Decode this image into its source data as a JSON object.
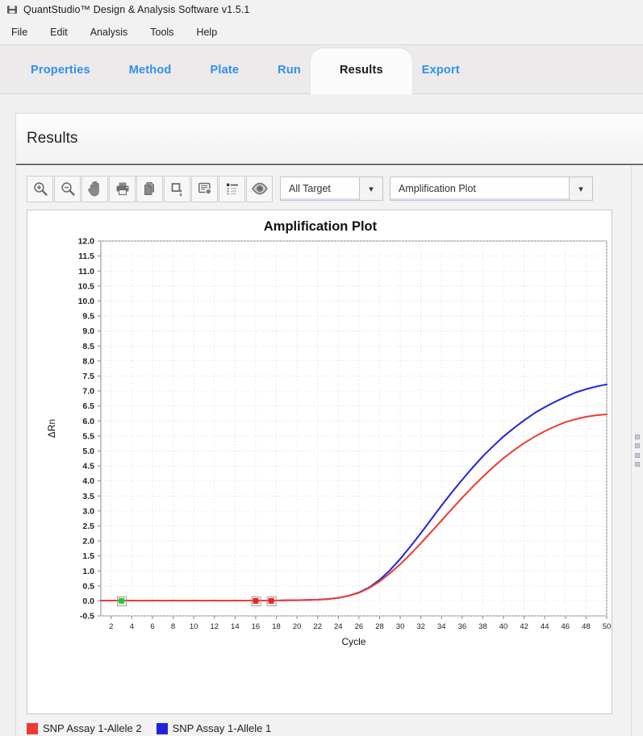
{
  "window": {
    "title": "QuantStudio™ Design & Analysis Software v1.5.1",
    "app_icon": "disk-icon"
  },
  "menubar": {
    "items": [
      {
        "label": "File"
      },
      {
        "label": "Edit"
      },
      {
        "label": "Analysis"
      },
      {
        "label": "Tools"
      },
      {
        "label": "Help"
      }
    ]
  },
  "tabs": [
    {
      "label": "Properties",
      "active": false
    },
    {
      "label": "Method",
      "active": false
    },
    {
      "label": "Plate",
      "active": false
    },
    {
      "label": "Run",
      "active": false
    },
    {
      "label": "Results",
      "active": true
    },
    {
      "label": "Export",
      "active": false
    }
  ],
  "panel": {
    "header_title": "Results"
  },
  "toolbar": {
    "buttons": [
      {
        "name": "zoom-in-icon",
        "tooltip": "Zoom In"
      },
      {
        "name": "zoom-out-icon",
        "tooltip": "Zoom Out"
      },
      {
        "name": "pan-hand-icon",
        "tooltip": "Pan"
      },
      {
        "name": "print-icon",
        "tooltip": "Print"
      },
      {
        "name": "copy-icon",
        "tooltip": "Copy"
      },
      {
        "name": "export-image-icon",
        "tooltip": "Export Image"
      },
      {
        "name": "report-icon",
        "tooltip": "Report"
      },
      {
        "name": "list-icon",
        "tooltip": "Legend List"
      },
      {
        "name": "eye-icon",
        "tooltip": "Show/Hide"
      }
    ],
    "target_select": {
      "value": "All Target",
      "arrow": "chevron-down-icon"
    },
    "plot_select": {
      "value": "Amplification Plot",
      "arrow": "chevron-down-icon"
    },
    "nav_prev": "chevron-left-icon",
    "nav_next": "chevron-right-icon"
  },
  "colors": {
    "allele1_blue": "#2222dd",
    "allele2_red": "#ee3b32",
    "tab_link_blue": "#2f90ef",
    "grid": "#d9d9d9",
    "axis": "#888888"
  },
  "legend": [
    {
      "label": "SNP Assay 1-Allele 2",
      "color": "#ee3b32"
    },
    {
      "label": "SNP Assay 1-Allele 1",
      "color": "#2222dd"
    }
  ],
  "chart_data": {
    "type": "line",
    "title": "Amplification Plot",
    "xlabel": "Cycle",
    "ylabel": "ΔRn",
    "xlim": [
      1,
      50
    ],
    "ylim": [
      -0.5,
      12.0
    ],
    "xticks": [
      2,
      4,
      6,
      8,
      10,
      12,
      14,
      16,
      18,
      20,
      22,
      24,
      26,
      28,
      30,
      32,
      34,
      36,
      38,
      40,
      42,
      44,
      46,
      48,
      50
    ],
    "yticks": [
      -0.5,
      0.0,
      0.5,
      1.0,
      1.5,
      2.0,
      2.5,
      3.0,
      3.5,
      4.0,
      4.5,
      5.0,
      5.5,
      6.0,
      6.5,
      7.0,
      7.5,
      8.0,
      8.5,
      9.0,
      9.5,
      10.0,
      10.5,
      11.0,
      11.5,
      12.0
    ],
    "grid": true,
    "legend_position": "below-plot",
    "x": [
      1,
      2,
      3,
      4,
      5,
      6,
      7,
      8,
      9,
      10,
      11,
      12,
      13,
      14,
      15,
      16,
      17,
      18,
      19,
      20,
      21,
      22,
      23,
      24,
      25,
      26,
      27,
      28,
      29,
      30,
      31,
      32,
      33,
      34,
      35,
      36,
      37,
      38,
      39,
      40,
      41,
      42,
      43,
      44,
      45,
      46,
      47,
      48,
      49,
      50
    ],
    "series": [
      {
        "name": "SNP Assay 1-Allele 1",
        "color": "#2222dd",
        "values": [
          0.01,
          0.01,
          0.01,
          0.01,
          0.01,
          0.01,
          0.01,
          0.01,
          0.01,
          0.01,
          0.01,
          0.01,
          0.01,
          0.01,
          0.01,
          0.01,
          0.01,
          0.01,
          0.02,
          0.02,
          0.03,
          0.04,
          0.06,
          0.1,
          0.17,
          0.28,
          0.45,
          0.7,
          1.02,
          1.4,
          1.82,
          2.26,
          2.72,
          3.18,
          3.62,
          4.04,
          4.44,
          4.82,
          5.16,
          5.48,
          5.76,
          6.02,
          6.26,
          6.46,
          6.64,
          6.8,
          6.95,
          7.06,
          7.15,
          7.22
        ]
      },
      {
        "name": "SNP Assay 1-Allele 2",
        "color": "#ee3b32",
        "values": [
          0.01,
          0.01,
          0.01,
          0.01,
          0.01,
          0.01,
          0.01,
          0.01,
          0.01,
          0.01,
          0.01,
          0.01,
          0.01,
          0.01,
          0.01,
          0.01,
          0.01,
          0.01,
          0.02,
          0.02,
          0.03,
          0.04,
          0.06,
          0.1,
          0.17,
          0.27,
          0.43,
          0.65,
          0.92,
          1.22,
          1.56,
          1.92,
          2.3,
          2.68,
          3.06,
          3.44,
          3.8,
          4.14,
          4.46,
          4.76,
          5.02,
          5.26,
          5.47,
          5.66,
          5.82,
          5.96,
          6.06,
          6.14,
          6.19,
          6.22
        ]
      }
    ],
    "markers": [
      {
        "name": "baseline-start-marker",
        "cycle": 3,
        "value": 0.0,
        "color": "#22cc33"
      },
      {
        "name": "baseline-end-marker-1",
        "cycle": 16,
        "value": 0.0,
        "color": "#ee2222"
      },
      {
        "name": "baseline-end-marker-2",
        "cycle": 17.5,
        "value": 0.0,
        "color": "#ee2222"
      }
    ]
  }
}
